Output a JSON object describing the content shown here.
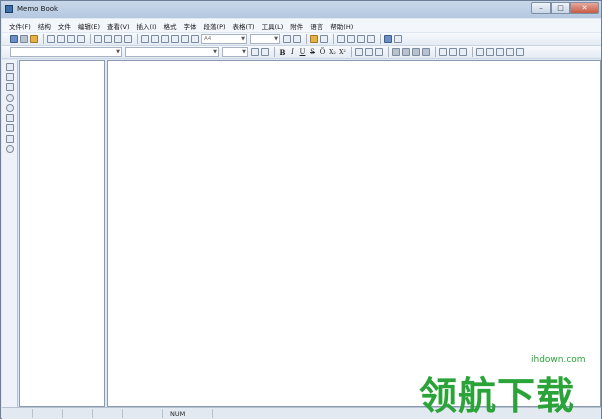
{
  "window": {
    "title": "Memo Book"
  },
  "menu": [
    "文件(F)",
    "结构",
    "文件",
    "编辑(E)",
    "查看(V)",
    "插入(I)",
    "格式",
    "字体",
    "段落(P)",
    "表格(T)",
    "工具(L)",
    "附件",
    "语言",
    "帮助(H)"
  ],
  "toolbar": {
    "page_size": "A4",
    "font_name": "",
    "font_size": "",
    "format_buttons": [
      "B",
      "I",
      "U",
      "S",
      "Ö",
      "X₂",
      "X²"
    ]
  },
  "statusbar": {
    "num": "NUM"
  },
  "watermark": {
    "text": "领航下载",
    "url": "ihdown.com"
  },
  "icons": {
    "toolbar1": [
      "open-icon",
      "save-icon",
      "color-icon",
      "save-all-icon",
      "print-icon",
      "cut-icon",
      "copy-icon",
      "paste-icon",
      "undo-icon",
      "redo-icon",
      "find-icon",
      "page-icon",
      "table-icon",
      "zoom-fit-icon",
      "zoom-page-icon",
      "color-fill-icon",
      "line-icon",
      "image-icon",
      "spell-icon"
    ],
    "left_strip": [
      "tree-icon",
      "new-icon",
      "link-icon",
      "delete-icon",
      "search-icon",
      "up-icon",
      "down-icon",
      "save-icon",
      "globe-icon"
    ]
  }
}
